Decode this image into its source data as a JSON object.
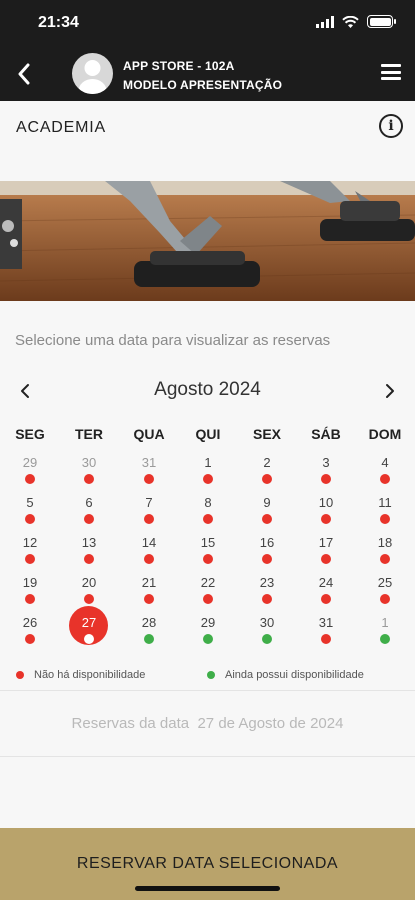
{
  "status_bar": {
    "time": "21:34"
  },
  "navbar": {
    "title_line1": "APP STORE - 102A",
    "title_line2": "MODELO APRESENTAÇÃO"
  },
  "section": {
    "title": "ACADEMIA"
  },
  "instruction": "Selecione uma data para visualizar as reservas",
  "calendar": {
    "month_label": "Agosto 2024",
    "weekdays": [
      "SEG",
      "TER",
      "QUA",
      "QUI",
      "SEX",
      "SÁB",
      "DOM"
    ],
    "weeks": [
      [
        {
          "d": "29",
          "s": "red",
          "other": true
        },
        {
          "d": "30",
          "s": "red",
          "other": true
        },
        {
          "d": "31",
          "s": "red",
          "other": true
        },
        {
          "d": "1",
          "s": "red"
        },
        {
          "d": "2",
          "s": "red"
        },
        {
          "d": "3",
          "s": "red"
        },
        {
          "d": "4",
          "s": "red"
        }
      ],
      [
        {
          "d": "5",
          "s": "red"
        },
        {
          "d": "6",
          "s": "red"
        },
        {
          "d": "7",
          "s": "red"
        },
        {
          "d": "8",
          "s": "red"
        },
        {
          "d": "9",
          "s": "red"
        },
        {
          "d": "10",
          "s": "red"
        },
        {
          "d": "11",
          "s": "red"
        }
      ],
      [
        {
          "d": "12",
          "s": "red"
        },
        {
          "d": "13",
          "s": "red"
        },
        {
          "d": "14",
          "s": "red"
        },
        {
          "d": "15",
          "s": "red"
        },
        {
          "d": "16",
          "s": "red"
        },
        {
          "d": "17",
          "s": "red"
        },
        {
          "d": "18",
          "s": "red"
        }
      ],
      [
        {
          "d": "19",
          "s": "red"
        },
        {
          "d": "20",
          "s": "red"
        },
        {
          "d": "21",
          "s": "red"
        },
        {
          "d": "22",
          "s": "red"
        },
        {
          "d": "23",
          "s": "red"
        },
        {
          "d": "24",
          "s": "red"
        },
        {
          "d": "25",
          "s": "red"
        }
      ],
      [
        {
          "d": "26",
          "s": "red"
        },
        {
          "d": "27",
          "s": "selected"
        },
        {
          "d": "28",
          "s": "green"
        },
        {
          "d": "29",
          "s": "green"
        },
        {
          "d": "30",
          "s": "green"
        },
        {
          "d": "31",
          "s": "red"
        },
        {
          "d": "1",
          "s": "green",
          "other": true
        }
      ]
    ]
  },
  "legend": {
    "unavailable": "Não há disponibilidade",
    "available": "Ainda possui disponibilidade"
  },
  "reservas": {
    "label": "Reservas da data",
    "date": "27 de Agosto de 2024"
  },
  "reserve_button": "RESERVAR DATA SELECIONADA",
  "colors": {
    "unavailable": "#e8332a",
    "available": "#3fae49",
    "button": "#b9a36b",
    "navbar": "#1c1c1c"
  },
  "icons": {
    "back": "chevron-left-icon",
    "menu": "hamburger-menu-icon",
    "info": "info-icon",
    "avatar": "user-avatar-icon"
  }
}
